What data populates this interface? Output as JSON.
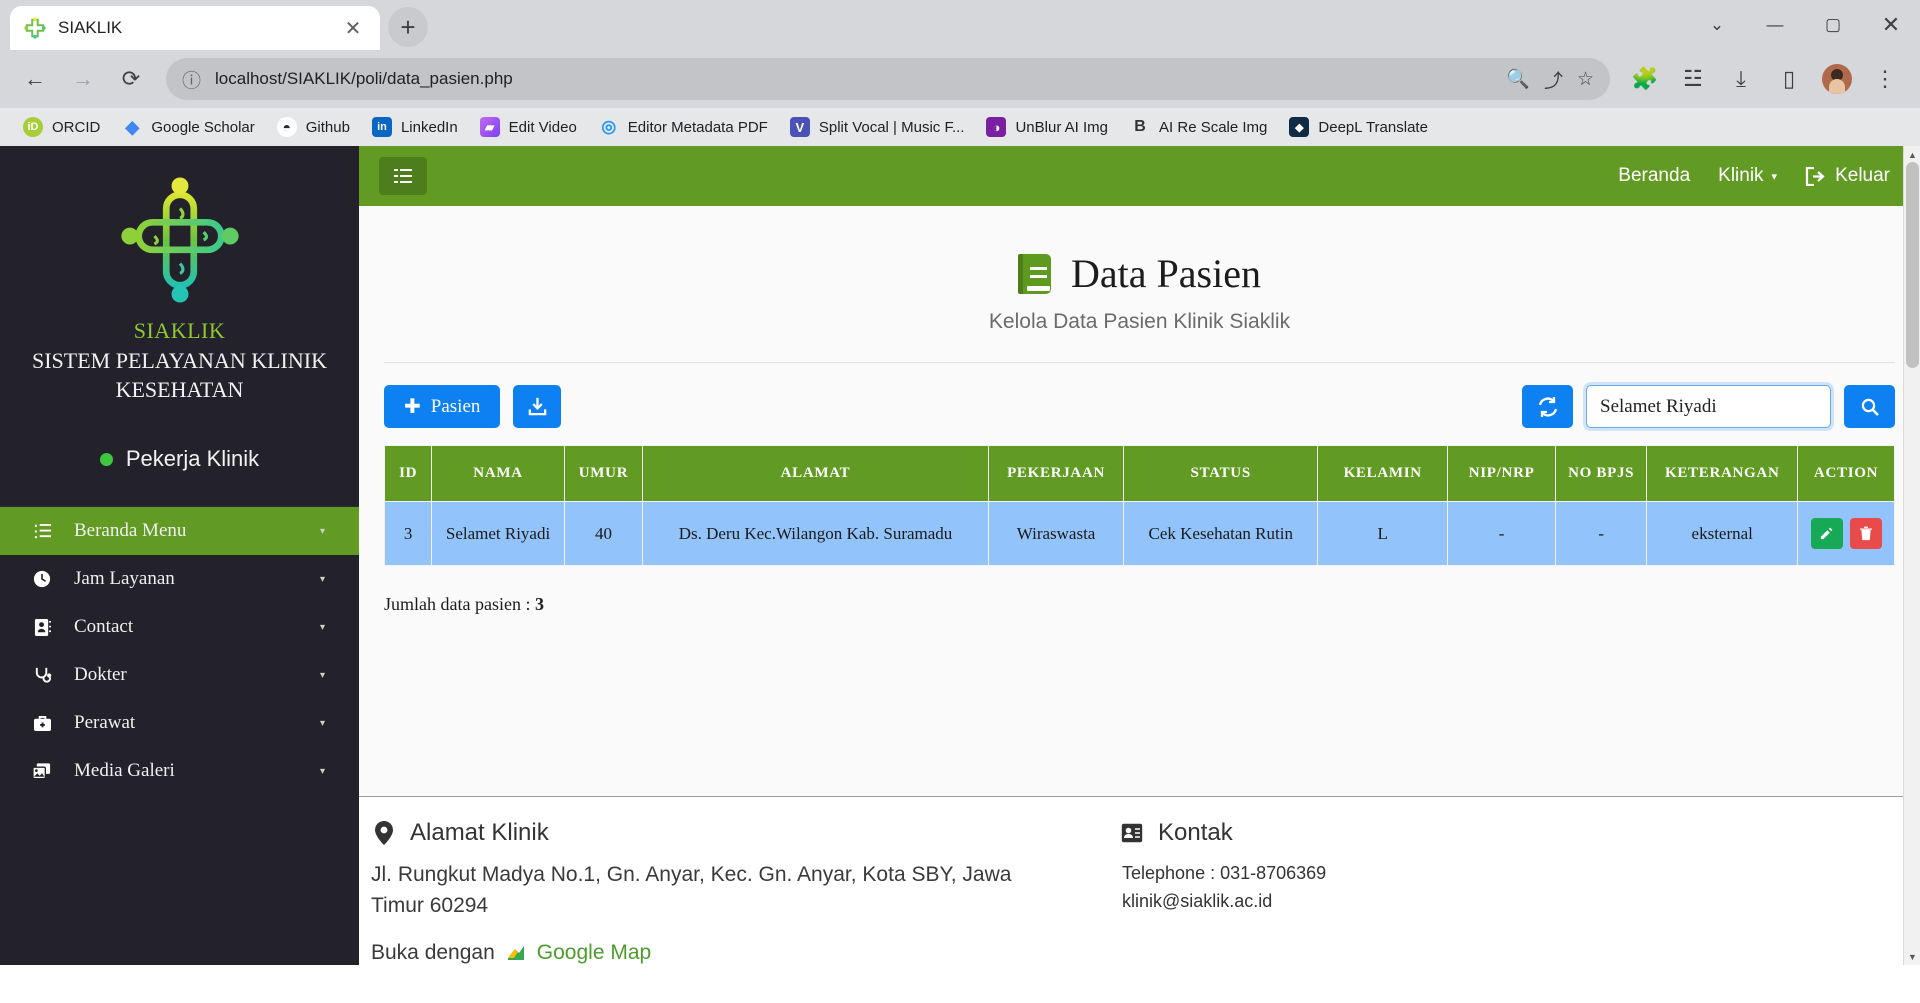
{
  "browser": {
    "tab_title": "SIAKLIK",
    "tab_favicon": "siaklik-cross-icon",
    "close_tab_glyph": "✕",
    "new_tab_glyph": "+",
    "window_controls": {
      "minimize": "—",
      "maximize": "▢",
      "close": "✕",
      "chevron": "⌄"
    },
    "nav": {
      "back": "←",
      "forward": "→",
      "reload": "⟳"
    },
    "url": "localhost/SIAKLIK/poli/data_pasien.php",
    "site_info_glyph": "ⓘ",
    "omnibox_icons": [
      "zoom-icon",
      "share-icon",
      "bookmark-star-icon"
    ],
    "toolbar_icons": [
      "extensions-icon",
      "reading-list-icon",
      "downloads-icon",
      "side-panel-icon",
      "profile-avatar",
      "menu-icon"
    ],
    "bookmarks": [
      {
        "label": "ORCID",
        "color": "#a6ce39",
        "glyph": "iD"
      },
      {
        "label": "Google Scholar",
        "color": "#4285f4",
        "glyph": "▲"
      },
      {
        "label": "Github",
        "color": "#ffffff",
        "glyph": "◉"
      },
      {
        "label": "LinkedIn",
        "color": "#0a66c2",
        "glyph": "in"
      },
      {
        "label": "Edit Video",
        "color": "#a34bdb",
        "glyph": "▰"
      },
      {
        "label": "Editor Metadata PDF",
        "color": "#2196f3",
        "glyph": "◎"
      },
      {
        "label": "Split Vocal | Music F...",
        "color": "#4b51b5",
        "glyph": "V"
      },
      {
        "label": "UnBlur AI Img",
        "color": "#7b1fa2",
        "glyph": "◑"
      },
      {
        "label": "AI Re Scale Img",
        "color": "#f0f0f0",
        "glyph": "B"
      },
      {
        "label": "DeepL Translate",
        "color": "#0f2b46",
        "glyph": "◆"
      }
    ]
  },
  "sidebar": {
    "logo_name": "siaklik-cross-logo",
    "brand_line1": "SIAKLIK",
    "brand_line2": "SISTEM PELAYANAN KLINIK KESEHATAN",
    "role_label": "Pekerja Klinik",
    "role_dot_color": "#3fc63f",
    "menu": [
      {
        "label": "Beranda Menu",
        "icon": "list-check-icon",
        "active": true,
        "caret": "▾"
      },
      {
        "label": "Jam Layanan",
        "icon": "clock-icon",
        "active": false,
        "caret": "▾"
      },
      {
        "label": "Contact",
        "icon": "address-book-icon",
        "active": false,
        "caret": "▾"
      },
      {
        "label": "Dokter",
        "icon": "stethoscope-icon",
        "active": false,
        "caret": "▾"
      },
      {
        "label": "Perawat",
        "icon": "medkit-icon",
        "active": false,
        "caret": "▾"
      },
      {
        "label": "Media Galeri",
        "icon": "images-icon",
        "active": false,
        "caret": "▾"
      }
    ]
  },
  "navbar": {
    "toggle_icon": "hamburger-icon",
    "links": [
      {
        "label": "Beranda",
        "icon": null,
        "caret": null
      },
      {
        "label": "Klinik",
        "icon": null,
        "caret": "▾"
      },
      {
        "label": "Keluar",
        "icon": "sign-out-icon",
        "caret": null
      }
    ],
    "bg_color": "#629b24"
  },
  "page_header": {
    "icon": "green-book-icon",
    "title": "Data Pasien",
    "subtitle": "Kelola Data Pasien Klinik Siaklik"
  },
  "toolbar": {
    "add_label": "Pasien",
    "add_glyph": "✚",
    "download_glyph": "⤓",
    "refresh_glyph": "⟳",
    "search_glyph": "🔍",
    "search_value": "Selamet Riyadi",
    "search_placeholder": "",
    "accent_color": "#0d80f2"
  },
  "table": {
    "columns": [
      "ID",
      "NAMA",
      "UMUR",
      "ALAMAT",
      "PEKERJAAN",
      "STATUS",
      "KELAMIN",
      "NIP/NRP",
      "NO BPJS",
      "KETERANGAN",
      "ACTION"
    ],
    "header_bg": "#629b24",
    "row_bg": "#92c4fb",
    "rows": [
      {
        "id": "3",
        "nama": "Selamet Riyadi",
        "umur": "40",
        "alamat": "Ds. Deru Kec.Wilangon Kab. Suramadu",
        "pekerjaan": "Wiraswasta",
        "status": "Cek Kesehatan Rutin",
        "kelamin": "L",
        "nip": "-",
        "bpjs": "-",
        "keterangan": "eksternal",
        "edit_glyph": "✎",
        "delete_glyph": "🗑"
      }
    ],
    "summary_label": "Jumlah data pasien :",
    "summary_value": "3"
  },
  "footer": {
    "address_heading": "Alamat Klinik",
    "address_icon": "map-marker-icon",
    "address_text": "Jl. Rungkut Madya No.1, Gn. Anyar, Kec. Gn. Anyar, Kota SBY, Jawa Timur 60294",
    "map_prefix": "Buka dengan",
    "map_link": "Google Map",
    "map_icon": "google-maps-icon",
    "contact_heading": "Kontak",
    "contact_icon": "id-card-icon",
    "phone": "Telephone : 031-8706369",
    "email": "klinik@siaklik.ac.id"
  },
  "scrollbar": {
    "up": "▲",
    "down": "▼"
  }
}
